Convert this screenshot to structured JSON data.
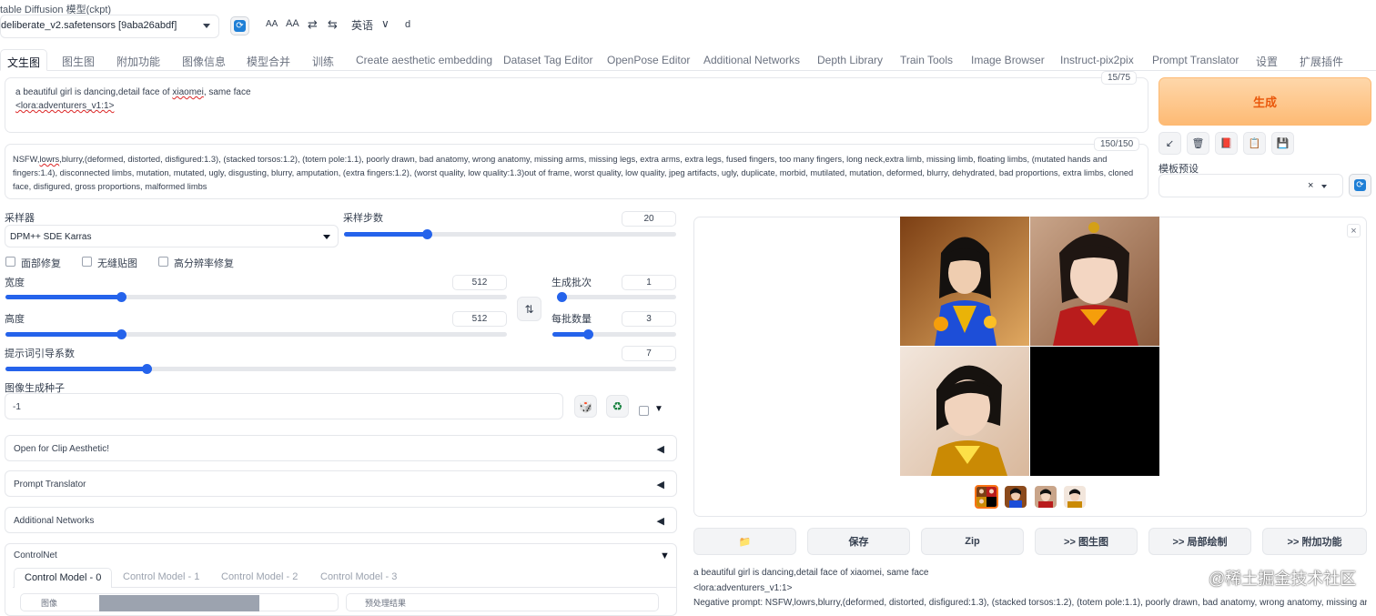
{
  "header": {
    "ckpt_label": "table Diffusion 模型(ckpt)",
    "ckpt_value": "deliberate_v2.safetensors [9aba26abdf]",
    "font_small": "AA",
    "font_large": "AA",
    "swap_a": "⇄",
    "swap_b": "⇆",
    "language": "英语",
    "lang_caret": "∨",
    "letter": "d"
  },
  "tabs": [
    "文生图",
    "图生图",
    "附加功能",
    "图像信息",
    "模型合并",
    "训练",
    "Create aesthetic embedding",
    "Dataset Tag Editor",
    "OpenPose Editor",
    "Additional Networks",
    "Depth Library",
    "Train Tools",
    "Image Browser",
    "Instruct-pix2pix",
    "Prompt Translator",
    "设置",
    "扩展插件"
  ],
  "prompt": {
    "line1_pre": "a beautiful girl is dancing,detail face of ",
    "line1_err": "xiaomei",
    "line1_post": ", same face",
    "line2": "<lora:adventurers_v1:1>",
    "counter": "15/75"
  },
  "negative": {
    "pre": "NSFW,",
    "err": "lowrs",
    "text": ",blurry,(deformed, distorted, disfigured:1.3), (stacked torsos:1.2), (totem pole:1.1), poorly drawn, bad anatomy, wrong anatomy, missing arms, missing legs, extra arms, extra legs, fused fingers, too many fingers, long neck,extra limb, missing limb, floating limbs, (mutated hands and fingers:1.4), disconnected limbs, mutation, mutated, ugly, disgusting, blurry, amputation, (extra fingers:1.2),  (worst quality, low quality:1.3)out of frame, worst quality, low quality, jpeg artifacts, ugly, duplicate, morbid, mutilated, mutation, deformed, blurry, dehydrated, bad proportions, extra limbs, cloned face, disfigured, gross proportions, malformed limbs",
    "counter": "150/150"
  },
  "generate": {
    "label": "生成",
    "tools": [
      "↙",
      "🗑",
      "📕",
      "📋",
      "💾"
    ],
    "styles_label": "模板预设",
    "styles_clear": "×"
  },
  "params": {
    "sampler_label": "采样器",
    "sampler_value": "DPM++ SDE Karras",
    "steps_label": "采样步数",
    "steps_value": "20",
    "steps": 0.25,
    "face_restore": "面部修复",
    "tiling": "无缝贴图",
    "hires": "高分辨率修复",
    "width_label": "宽度",
    "width_value": "512",
    "width": 0.23,
    "height_label": "高度",
    "height_value": "512",
    "height": 0.23,
    "batch_count_label": "生成批次",
    "batch_count_value": "1",
    "batch_count": 0.0,
    "batch_size_label": "每批数量",
    "batch_size_value": "3",
    "batch_size": 0.29,
    "swap_icon": "⇅",
    "cfg_label": "提示词引导系数",
    "cfg_value": "7",
    "cfg": 0.21,
    "seed_label": "图像生成种子",
    "seed_value": "-1",
    "dice": "🎲",
    "recycle": "♻",
    "extra_caret": "▼"
  },
  "accordions": [
    {
      "label": "Open for Clip Aesthetic!",
      "arrow": "◀"
    },
    {
      "label": "Prompt Translator",
      "arrow": "◀"
    },
    {
      "label": "Additional Networks",
      "arrow": "◀"
    },
    {
      "label": "ControlNet",
      "arrow": "▼"
    }
  ],
  "controlnet_tabs": [
    "Control Model - 0",
    "Control Model - 1",
    "Control Model - 2",
    "Control Model - 3"
  ],
  "controlnet_bottom": {
    "image_label": "图像",
    "preview_label": "预处理结果"
  },
  "output": {
    "close": "×",
    "buttons": [
      "📁",
      "保存",
      "Zip",
      ">> 图生图",
      ">> 局部绘制",
      ">> 附加功能"
    ],
    "info_line1": "a beautiful girl is dancing,detail face of xiaomei, same face",
    "info_line2": "<lora:adventurers_v1:1>",
    "info_line3": "Negative prompt: NSFW,lowrs,blurry,(deformed, distorted, disfigured:1.3), (stacked torsos:1.2), (totem pole:1.1), poorly drawn, bad anatomy, wrong anatomy, missing arms"
  },
  "watermark": "@稀土掘金技术社区",
  "colors": {
    "accent": "#2563eb",
    "generate": "#ea580c"
  }
}
